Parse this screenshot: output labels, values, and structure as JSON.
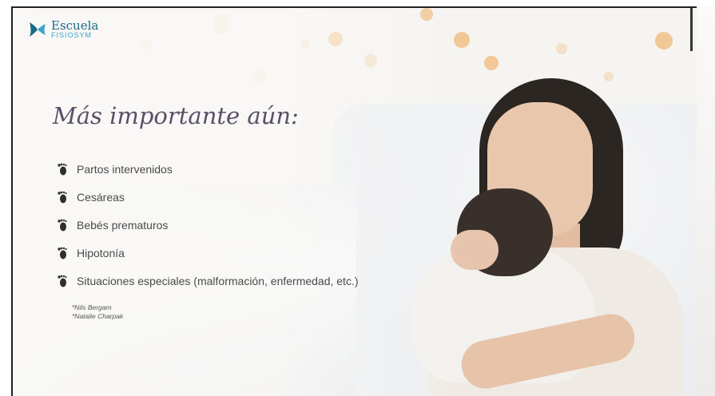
{
  "logo": {
    "line1": "Escuela",
    "line2": "FISIOSYM"
  },
  "slide": {
    "title": "Más importante aún:",
    "bullets": [
      "Partos intervenidos",
      "Cesáreas",
      "Bebés prematuros",
      "Hipotonía",
      "Situaciones especiales (malformación, enfermedad, etc.)"
    ],
    "bullet_icon": "baby-footprint-icon",
    "references": [
      "*Nils Bergam",
      "*Natalie Charpak"
    ]
  },
  "colors": {
    "title": "#5a4f68",
    "bullet_text": "#4a4a4a",
    "bullet_icon": "#2f2f2f",
    "logo_primary": "#1a6a86",
    "logo_secondary": "#3ba3c7",
    "background": "#f6f4f1"
  }
}
